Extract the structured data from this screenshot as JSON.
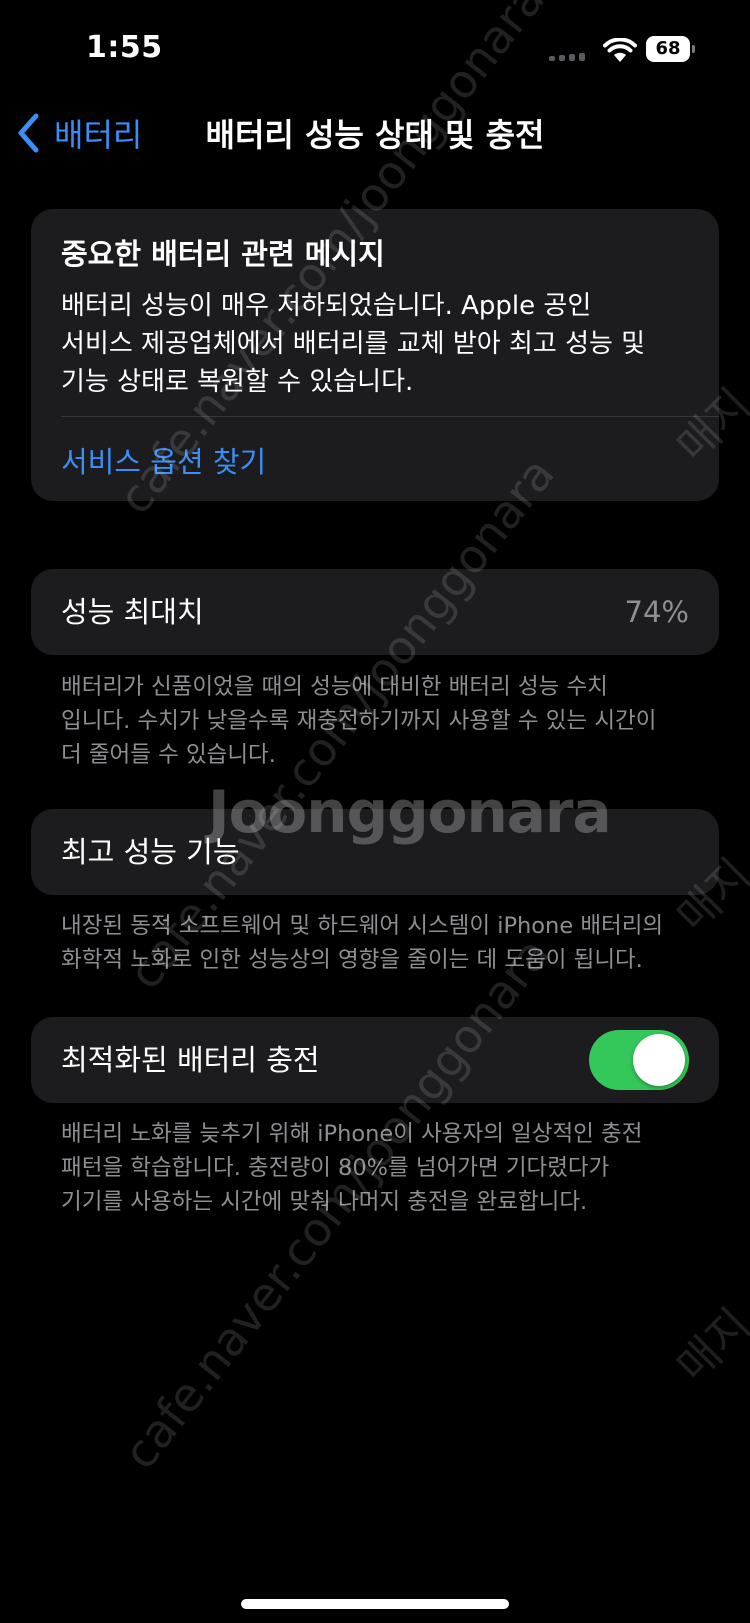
{
  "status_bar": {
    "time": "1:55",
    "battery_level": "68",
    "icons": [
      "cellular-signal-icon",
      "wifi-icon",
      "battery-icon"
    ]
  },
  "nav": {
    "back_label": "배터리",
    "title": "배터리 성능 상태 및 충전"
  },
  "message_card": {
    "title": "중요한 배터리 관련 메시지",
    "body_lines": [
      "배터리 성능이 매우 저하되었습니다. Apple 공인",
      "서비스 제공업체에서 배터리를 교체 받아 최고 성능 및",
      "기능 상태로 복원할 수 있습니다."
    ],
    "link": "서비스 옵션 찾기"
  },
  "max_capacity": {
    "label": "성능 최대치",
    "value": "74%",
    "footnote_lines": [
      "배터리가 신품이었을 때의 성능에 대비한 배터리 성능 수치",
      "입니다. 수치가 낮을수록 재충전하기까지 사용할 수 있는 시간이",
      "더 줄어들 수 있습니다."
    ]
  },
  "peak_performance": {
    "label": "최고 성능 기능",
    "footnote_lines": [
      "내장된 동적 소프트웨어 및 하드웨어 시스템이 iPhone 배터리의",
      "화학적 노화로 인한 성능상의 영향을 줄이는 데 도움이 됩니다."
    ]
  },
  "optimized_charging": {
    "label": "최적화된 배터리 충전",
    "enabled": true,
    "footnote_lines": [
      "배터리 노화를 늦추기 위해 iPhone이 사용자의 일상적인 충전",
      "패턴을 학습합니다. 충전량이 80%를 넘어가면 기다렸다가",
      "기기를 사용하는 시간에 맞춰 나머지 충전을 완료합니다."
    ]
  },
  "watermark": {
    "brand": "Joonggonara",
    "url_a": "cafe.naver.com/joonggonara",
    "url_b": "cafe.naver.com/joonggonara",
    "url_c": "cafe.naver.com/joonggonara",
    "side": "매지",
    "side_b": "매지",
    "side_c": "매지"
  },
  "colors": {
    "background": "#000000",
    "card": "#1c1c1e",
    "accent_blue": "#3a8ef6",
    "secondary_text": "#8e8e93",
    "toggle_on": "#34c759"
  }
}
